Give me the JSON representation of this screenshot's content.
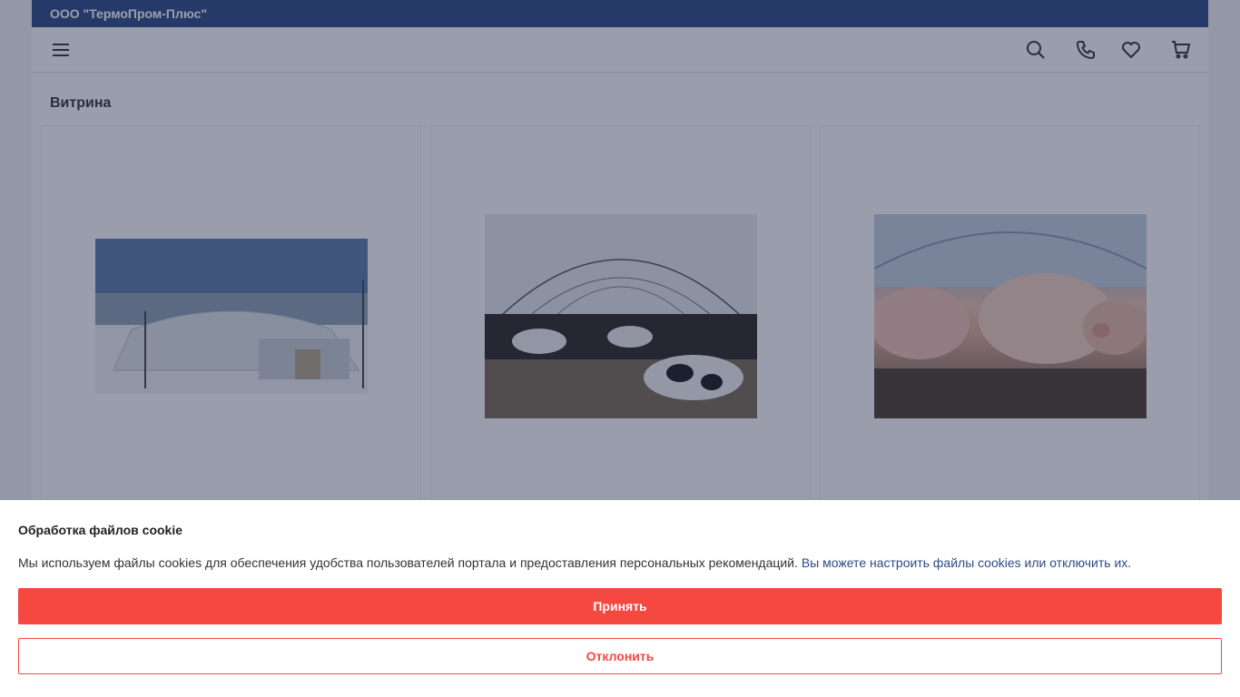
{
  "company": {
    "name": "ООО \"ТермоПром-Плюс\""
  },
  "navbar": {
    "menu_icon": "hamburger-icon",
    "icons": [
      "search-icon",
      "phone-icon",
      "heart-icon",
      "cart-icon"
    ]
  },
  "showcase": {
    "title": "Витрина",
    "cards": [
      {
        "image": "hangar-in-snow-photo"
      },
      {
        "image": "cows-in-barn-photo"
      },
      {
        "image": "pigs-in-barn-photo"
      }
    ]
  },
  "cookie": {
    "title": "Обработка файлов cookie",
    "text": "Мы используем файлы cookies для обеспечения удобства пользователей портала и предоставления персональных рекомендаций.",
    "link_text": "Вы можете настроить файлы cookies или отключить их.",
    "accept_label": "Принять",
    "decline_label": "Отклонить"
  },
  "colors": {
    "brand_blue": "#2c4a86",
    "accent_red": "#f44841"
  }
}
